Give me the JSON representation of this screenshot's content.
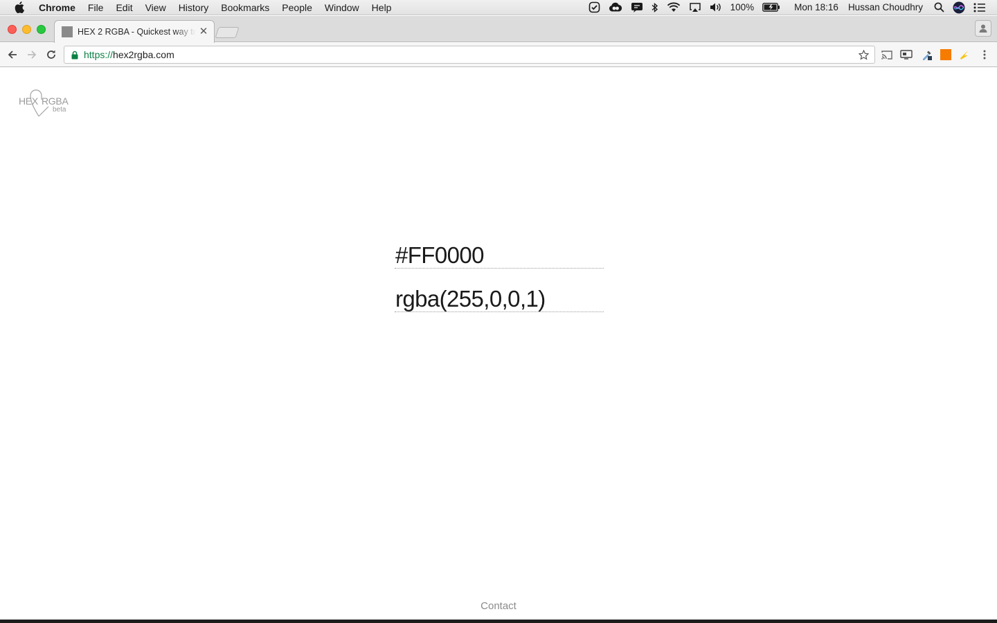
{
  "menubar": {
    "app": "Chrome",
    "items": [
      "File",
      "Edit",
      "View",
      "History",
      "Bookmarks",
      "People",
      "Window",
      "Help"
    ],
    "battery": "100%",
    "clock": "Mon 18:16",
    "user": "Hussan Choudhry",
    "status_icons": [
      "checkmark-circle-icon",
      "creative-cloud-icon",
      "megaphone-icon",
      "bluetooth-icon",
      "wifi-icon",
      "airplay-icon",
      "volume-icon",
      "battery-icon",
      "spotlight-search-icon",
      "siri-icon",
      "notification-center-icon"
    ]
  },
  "browser": {
    "tab": {
      "title": "HEX 2 RGBA - Quickest way to"
    },
    "address": {
      "scheme": "https://",
      "host": "hex2rgba.com"
    },
    "extensions": [
      "cast-icon",
      "screen-capture-icon",
      "eyedropper-icon",
      "orange-square-icon",
      "lightning-icon",
      "menu-dots-icon"
    ]
  },
  "page": {
    "logo": {
      "hex": "HEX",
      "rgba": "RGBA",
      "beta": "beta"
    },
    "hex_value": "#FF0000",
    "rgba_value": "rgba(255,0,0,1)",
    "footer_link": "Contact"
  },
  "colors": {
    "accent_secure": "#0b8043",
    "extension_orange": "#f57c00",
    "lightning_yellow": "#f5c518"
  }
}
